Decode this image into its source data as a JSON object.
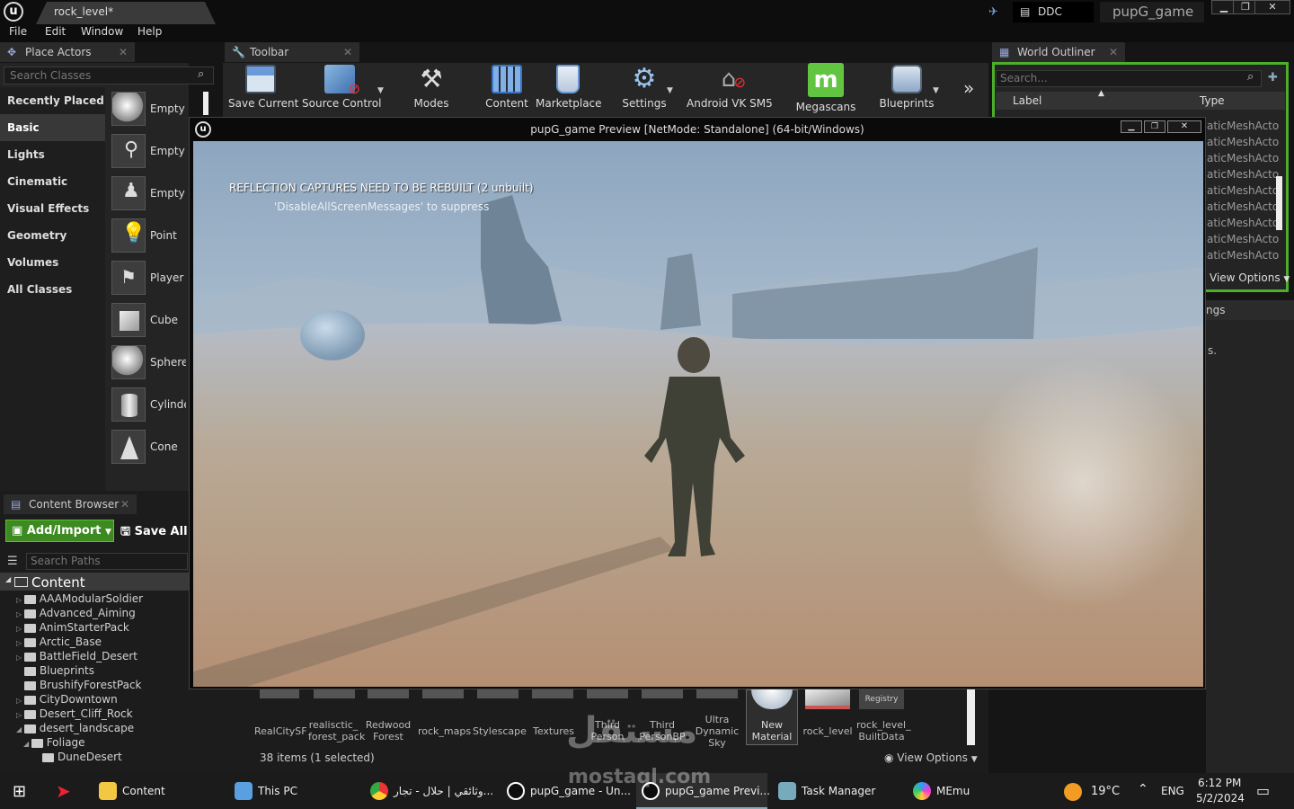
{
  "titlebar": {
    "doc_tab": "rock_level*",
    "ddc": "DDC",
    "project": "pupG_game"
  },
  "menu": [
    "File",
    "Edit",
    "Window",
    "Help"
  ],
  "place_actors": {
    "tab": "Place Actors",
    "search_placeholder": "Search Classes",
    "categories": [
      "Recently Placed",
      "Basic",
      "Lights",
      "Cinematic",
      "Visual Effects",
      "Geometry",
      "Volumes",
      "All Classes"
    ],
    "active_category": "Basic",
    "actors": [
      "Empty",
      "Empty",
      "Empty",
      "Point",
      "Player",
      "Cube",
      "Sphere",
      "Cylinder",
      "Cone"
    ]
  },
  "toolbar": {
    "tab": "Toolbar",
    "buttons": [
      "Save Current",
      "Source Control",
      "Modes",
      "Content",
      "Marketplace",
      "Settings",
      "Android VK SM5",
      "Megascans",
      "Blueprints"
    ]
  },
  "outliner": {
    "tab": "World Outliner",
    "search_placeholder": "Search...",
    "col_label": "Label",
    "col_type": "Type",
    "rows": [
      "aticMeshActo",
      "aticMeshActo",
      "aticMeshActo",
      "aticMeshActo",
      "aticMeshActo",
      "aticMeshActo",
      "aticMeshActo",
      "aticMeshActo",
      "aticMeshActo"
    ],
    "view_options": "View Options",
    "details_fragment": "ngs",
    "details_text": "s."
  },
  "content_browser": {
    "tab": "Content Browser",
    "add_import": "Add/Import",
    "save_all": "Save All",
    "search_paths": "Search Paths",
    "root": "Content",
    "folders": [
      "AAAModularSoldier",
      "Advanced_Aiming",
      "AnimStarterPack",
      "Arctic_Base",
      "BattleField_Desert",
      "Blueprints",
      "BrushifyForestPack",
      "CityDowntown",
      "Desert_Cliff_Rock",
      "desert_landscape",
      "Foliage",
      "DuneDesert"
    ],
    "assets": [
      "RealCitySF",
      "realisctic_ forest_pack",
      "Redwood Forest",
      "rock_maps",
      "Stylescape",
      "Textures",
      "Third Person",
      "Third PersonBP",
      "Ultra Dynamic Sky",
      "New Material",
      "rock_level",
      "rock_level_ BuiltData"
    ],
    "registry": "Registry",
    "status": "38 items (1 selected)",
    "view_options": "View Options"
  },
  "preview": {
    "title": "pupG_game Preview [NetMode: Standalone]  (64-bit/Windows)",
    "msg1": "REFLECTION CAPTURES NEED TO BE REBUILT (2 unbuilt)",
    "msg2": "'DisableAllScreenMessages' to suppress"
  },
  "watermark": {
    "arabic": "مستقل",
    "latin": "mostaql.com"
  },
  "taskbar": {
    "apps": [
      "Content",
      "This PC",
      "وثائقي | حلال - تجار...",
      "pupG_game - Un...",
      "pupG_game Previ...",
      "Task Manager",
      "MEmu"
    ],
    "weather": "19°C",
    "lang": "ENG",
    "time": "6:12 PM",
    "date": "5/2/2024"
  },
  "colors": {
    "accent_green": "#4cae2b",
    "panel": "#242424",
    "megascans": "#62c542"
  }
}
